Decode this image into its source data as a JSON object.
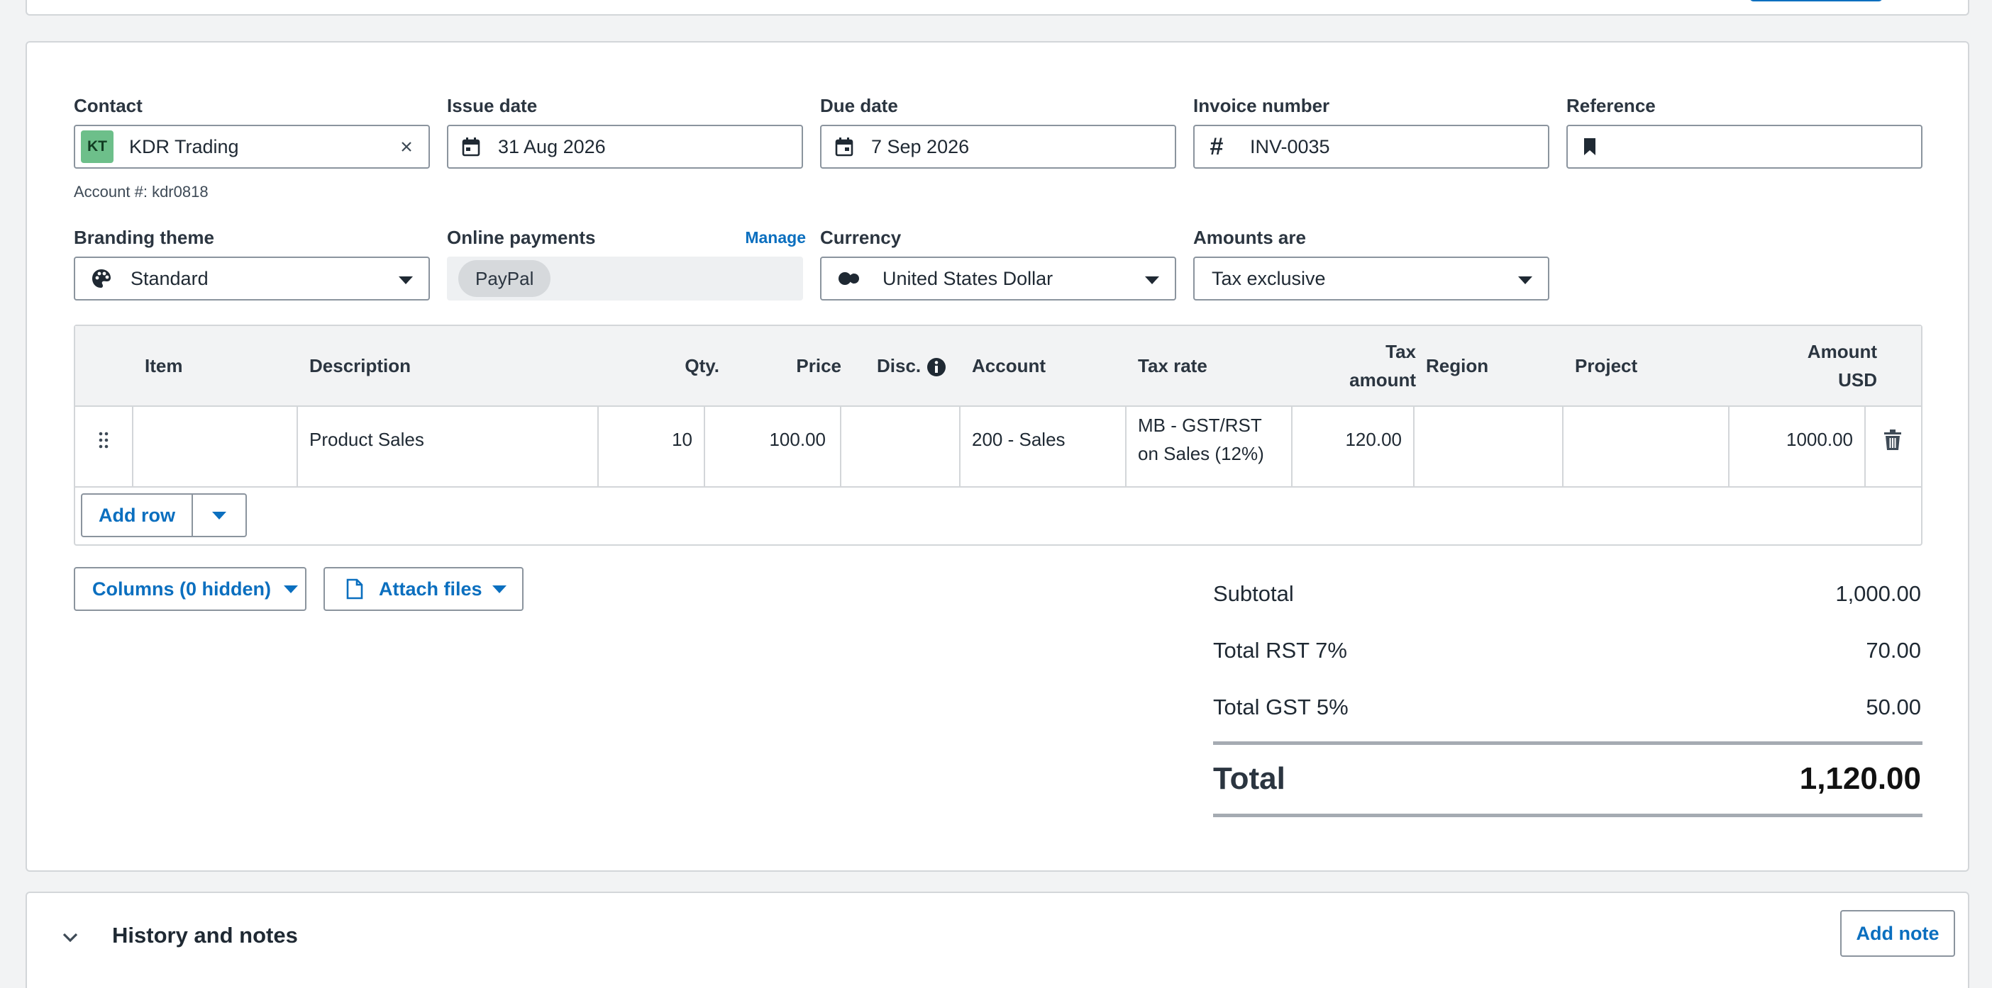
{
  "contact": {
    "label": "Contact",
    "avatar_initials": "KT",
    "avatar_color": "#6dbf8a",
    "value": "KDR Trading",
    "clear_icon": "close-icon",
    "account_note": "Account #: kdr0818"
  },
  "issue_date": {
    "label": "Issue date",
    "value": "31 Aug 2026",
    "icon": "calendar-icon"
  },
  "due_date": {
    "label": "Due date",
    "value": "7 Sep 2026",
    "icon": "calendar-icon"
  },
  "invoice_number": {
    "label": "Invoice number",
    "value": "INV-0035",
    "icon": "hash-icon"
  },
  "reference": {
    "label": "Reference",
    "value": "",
    "icon": "bookmark-icon"
  },
  "branding_theme": {
    "label": "Branding theme",
    "value": "Standard",
    "icon": "palette-icon"
  },
  "online_payments": {
    "label": "Online payments",
    "manage_label": "Manage",
    "provider": "PayPal"
  },
  "currency": {
    "label": "Currency",
    "value": "United States Dollar",
    "icon": "currency-icon"
  },
  "amounts_are": {
    "label": "Amounts are",
    "value": "Tax exclusive"
  },
  "table": {
    "headers": {
      "item": "Item",
      "description": "Description",
      "qty": "Qty.",
      "price": "Price",
      "disc": "Disc.",
      "account": "Account",
      "tax_rate": "Tax rate",
      "tax_amount_1": "Tax",
      "tax_amount_2": "amount",
      "region": "Region",
      "project": "Project",
      "amount_1": "Amount",
      "amount_2": "USD"
    },
    "rows": [
      {
        "item": "",
        "description": "Product Sales",
        "qty": "10",
        "price": "100.00",
        "disc": "",
        "account": "200 - Sales",
        "tax_rate_1": "MB - GST/RST",
        "tax_rate_2": "on Sales (12%)",
        "tax_amount": "120.00",
        "region": "",
        "project": "",
        "amount": "1000.00"
      }
    ],
    "add_row_label": "Add row"
  },
  "columns_button": "Columns (0 hidden)",
  "attach_button": "Attach files",
  "totals": {
    "subtotal_label": "Subtotal",
    "subtotal_value": "1,000.00",
    "rst_label": "Total RST 7%",
    "rst_value": "70.00",
    "gst_label": "Total GST 5%",
    "gst_value": "50.00",
    "total_label": "Total",
    "total_value": "1,120.00"
  },
  "history": {
    "title": "History and notes",
    "add_note_label": "Add note"
  },
  "colors": {
    "accent": "#0b6fbf",
    "border": "#8b949e",
    "background": "#f2f3f4"
  }
}
